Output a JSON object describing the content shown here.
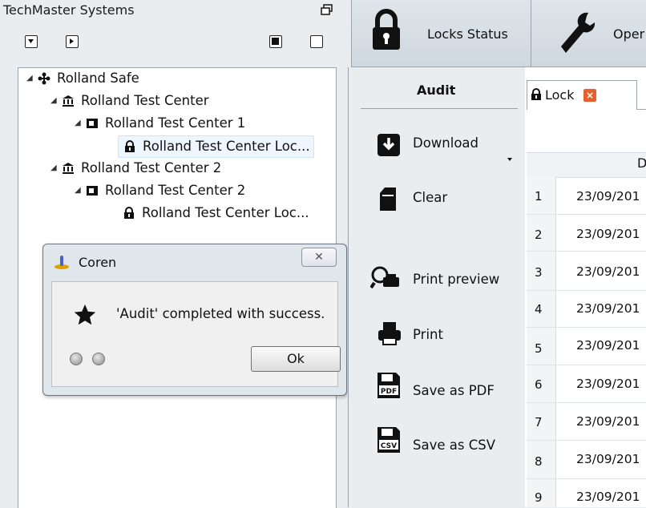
{
  "left_panel": {
    "title": "TechMaster Systems"
  },
  "tree": {
    "nodes": [
      {
        "label": "Rolland Safe"
      },
      {
        "label": "Rolland Test Center"
      },
      {
        "label": "Rolland Test Center 1"
      },
      {
        "label": "Rolland Test Center Loc..."
      },
      {
        "label": "Rolland Test Center 2"
      },
      {
        "label": "Rolland Test Center 2"
      },
      {
        "label": "Rolland Test Center Loc..."
      }
    ]
  },
  "dialog": {
    "title": "Coren",
    "message": "'Audit' completed with success.",
    "ok_label": "Ok",
    "close_glyph": "✕"
  },
  "toolbar": {
    "locks_status": "Locks Status",
    "operations": "Oper"
  },
  "audit": {
    "title": "Audit",
    "actions": [
      {
        "label": "Download"
      },
      {
        "label": "Clear"
      },
      {
        "label": "Print preview"
      },
      {
        "label": "Print"
      },
      {
        "label": "Save as PDF"
      },
      {
        "label": "Save as CSV"
      }
    ]
  },
  "tab": {
    "label": "Lock",
    "close_glyph": "×"
  },
  "grid": {
    "header": "D",
    "rows": [
      {
        "num": "1",
        "value": "23/09/201"
      },
      {
        "num": "2",
        "value": "23/09/201"
      },
      {
        "num": "3",
        "value": "23/09/201"
      },
      {
        "num": "4",
        "value": "23/09/201"
      },
      {
        "num": "5",
        "value": "23/09/201"
      },
      {
        "num": "6",
        "value": "23/09/201"
      },
      {
        "num": "7",
        "value": "23/09/201"
      },
      {
        "num": "8",
        "value": "23/09/201"
      },
      {
        "num": "9",
        "value": "23/09/201"
      }
    ]
  }
}
